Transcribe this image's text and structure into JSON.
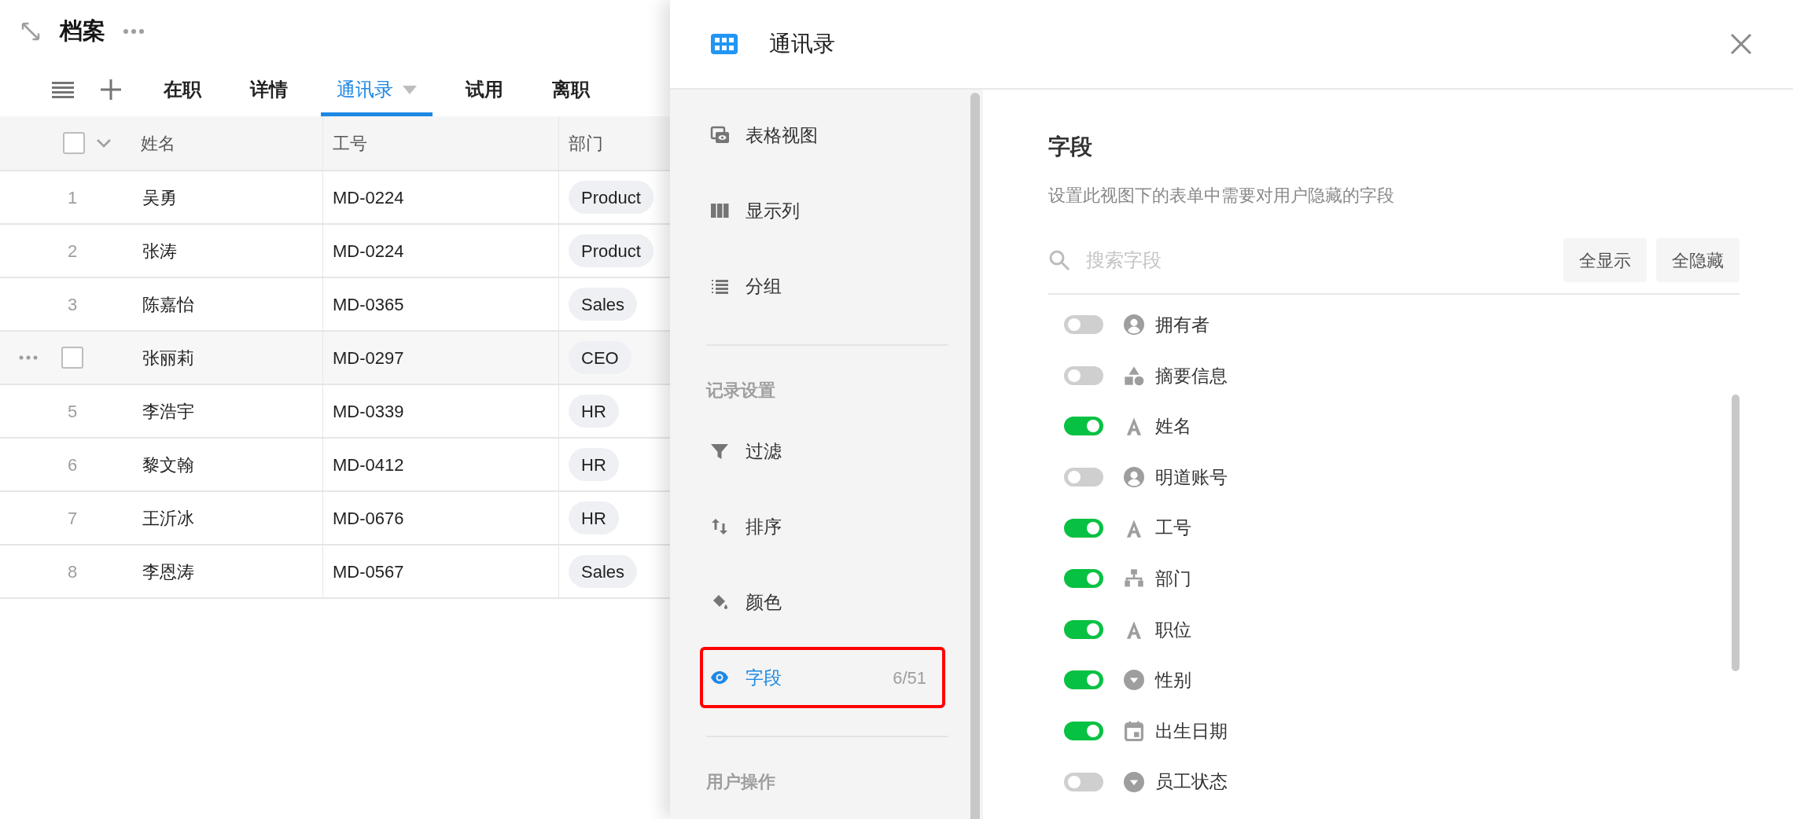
{
  "page": {
    "title": "档案"
  },
  "tabs": [
    {
      "label": "在职",
      "selected": false
    },
    {
      "label": "详情",
      "selected": false
    },
    {
      "label": "通讯录",
      "selected": true
    },
    {
      "label": "试用",
      "selected": false
    },
    {
      "label": "离职",
      "selected": false
    }
  ],
  "table": {
    "select_all": {
      "checked": false
    },
    "columns": [
      "姓名",
      "工号",
      "部门"
    ],
    "rows": [
      {
        "number": "1",
        "name": "吴勇",
        "id": "MD-0224",
        "dept": "Product",
        "hovered": false
      },
      {
        "number": "2",
        "name": "张涛",
        "id": "MD-0224",
        "dept": "Product",
        "hovered": false
      },
      {
        "number": "3",
        "name": "陈嘉怡",
        "id": "MD-0365",
        "dept": "Sales",
        "hovered": false
      },
      {
        "name": "张丽莉",
        "id": "MD-0297",
        "dept": "CEO",
        "hovered": true,
        "checked": false
      },
      {
        "number": "5",
        "name": "李浩宇",
        "id": "MD-0339",
        "dept": "HR",
        "hovered": false
      },
      {
        "number": "6",
        "name": "黎文翰",
        "id": "MD-0412",
        "dept": "HR",
        "hovered": false
      },
      {
        "number": "7",
        "name": "王沂冰",
        "id": "MD-0676",
        "dept": "HR",
        "hovered": false
      },
      {
        "number": "8",
        "name": "李恩涛",
        "id": "MD-0567",
        "dept": "Sales",
        "hovered": false
      }
    ]
  },
  "panel": {
    "title": "通讯录",
    "menu": [
      {
        "kind": "item",
        "label": "表格视图",
        "selected": false
      },
      {
        "kind": "item",
        "label": "显示列",
        "selected": false
      },
      {
        "kind": "item",
        "label": "分组",
        "selected": false
      },
      {
        "kind": "divider"
      },
      {
        "kind": "section",
        "label": "记录设置"
      },
      {
        "kind": "item",
        "label": "过滤",
        "selected": false
      },
      {
        "kind": "item",
        "label": "排序",
        "selected": false
      },
      {
        "kind": "item",
        "label": "颜色",
        "selected": false
      },
      {
        "kind": "item",
        "label": "字段",
        "count": "6/51",
        "selected": true,
        "highlighted": true
      },
      {
        "kind": "divider"
      },
      {
        "kind": "section",
        "label": "用户操作"
      }
    ],
    "content": {
      "title": "字段",
      "description": "设置此视图下的表单中需要对用户隐藏的字段",
      "search_placeholder": "搜索字段",
      "buttons": [
        "全显示",
        "全隐藏"
      ],
      "fields": [
        {
          "label": "拥有者",
          "on": false
        },
        {
          "label": "摘要信息",
          "on": false
        },
        {
          "label": "姓名",
          "on": true
        },
        {
          "label": "明道账号",
          "on": false
        },
        {
          "label": "工号",
          "on": true
        },
        {
          "label": "部门",
          "on": true
        },
        {
          "label": "职位",
          "on": true
        },
        {
          "label": "性别",
          "on": true
        },
        {
          "label": "出生日期",
          "on": true
        },
        {
          "label": "员工状态",
          "on": false
        }
      ]
    }
  }
}
